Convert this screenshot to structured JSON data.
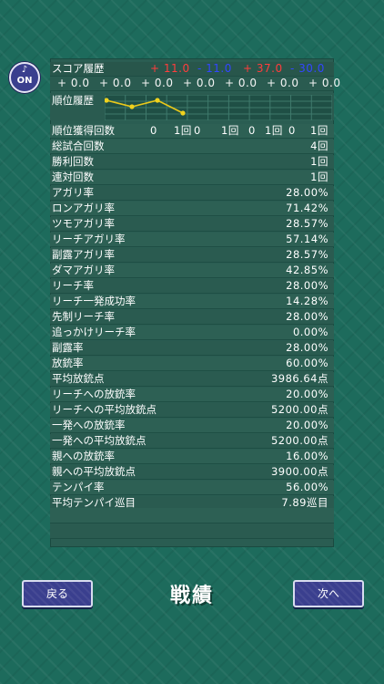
{
  "sound": {
    "note": "♪",
    "label": "ON"
  },
  "score_history": {
    "label": "スコア履歴",
    "values": [
      "+ 11.0",
      "- 11.0",
      "+ 37.0",
      "- 30.0"
    ],
    "colors": [
      "#ff3d3d",
      "#3246ff",
      "#ff3d3d",
      "#3246ff"
    ],
    "diffs": [
      "+ 0.0",
      "+ 0.0",
      "+ 0.0",
      "+ 0.0",
      "+ 0.0",
      "+ 0.0",
      "+ 0.0"
    ]
  },
  "rank_history": {
    "label": "順位履歴",
    "ranks": [
      1,
      2,
      1,
      3
    ]
  },
  "rank_counts": {
    "label": "順位獲得回数",
    "values": [
      "0",
      "1回",
      "0",
      "1回",
      "0",
      "1回",
      "0",
      "1回"
    ]
  },
  "stats": [
    {
      "label": "総試合回数",
      "value": "4回"
    },
    {
      "label": "勝利回数",
      "value": "1回"
    },
    {
      "label": "連対回数",
      "value": "1回"
    },
    {
      "label": "アガリ率",
      "value": "28.00%"
    },
    {
      "label": "ロンアガリ率",
      "value": "71.42%"
    },
    {
      "label": "ツモアガリ率",
      "value": "28.57%"
    },
    {
      "label": "リーチアガリ率",
      "value": "57.14%"
    },
    {
      "label": "副露アガリ率",
      "value": "28.57%"
    },
    {
      "label": "ダマアガリ率",
      "value": "42.85%"
    },
    {
      "label": "リーチ率",
      "value": "28.00%"
    },
    {
      "label": "リーチ一発成功率",
      "value": "14.28%"
    },
    {
      "label": "先制リーチ率",
      "value": "28.00%"
    },
    {
      "label": "追っかけリーチ率",
      "value": "0.00%"
    },
    {
      "label": "副露率",
      "value": "28.00%"
    },
    {
      "label": "放銃率",
      "value": "60.00%"
    },
    {
      "label": "平均放銃点",
      "value": "3986.64点"
    },
    {
      "label": "リーチへの放銃率",
      "value": "20.00%"
    },
    {
      "label": "リーチへの平均放銃点",
      "value": "5200.00点"
    },
    {
      "label": "一発への放銃率",
      "value": "20.00%"
    },
    {
      "label": "一発への平均放銃点",
      "value": "5200.00点"
    },
    {
      "label": "親への放銃率",
      "value": "16.00%"
    },
    {
      "label": "親への平均放銃点",
      "value": "3900.00点"
    },
    {
      "label": "テンパイ率",
      "value": "56.00%"
    },
    {
      "label": "平均テンパイ巡目",
      "value": "7.89巡目"
    }
  ],
  "footer": {
    "back": "戻る",
    "title": "戦績",
    "next": "次へ"
  }
}
